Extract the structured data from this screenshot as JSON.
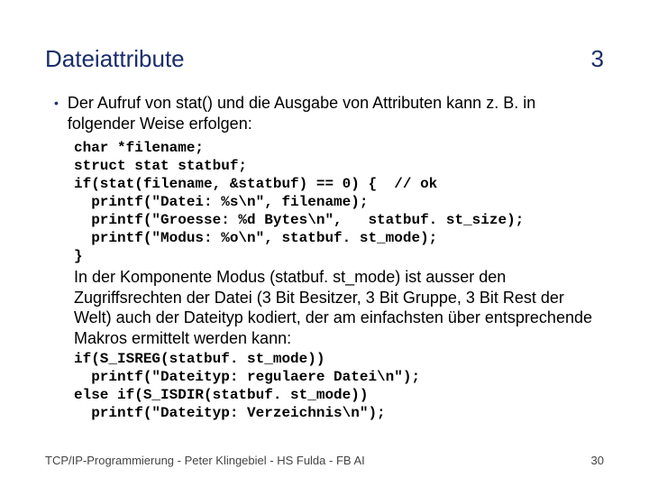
{
  "header": {
    "title": "Dateiattribute",
    "number": "3"
  },
  "bullet": {
    "text": "Der Aufruf von stat() und die Ausgabe von Attributen kann z. B. in folgender Weise erfolgen:"
  },
  "code1": "char *filename;\nstruct stat statbuf;\nif(stat(filename, &statbuf) == 0) {  // ok\n  printf(\"Datei: %s\\n\", filename);\n  printf(\"Groesse: %d Bytes\\n\",   statbuf. st_size);\n  printf(\"Modus: %o\\n\", statbuf. st_mode);\n}",
  "para1": "In der Komponente Modus (statbuf. st_mode) ist ausser den Zugriffsrechten der Datei (3 Bit Besitzer, 3 Bit Gruppe, 3 Bit Rest der Welt) auch der Dateityp kodiert, der am einfachsten über entsprechende Makros ermittelt werden kann:",
  "code2": "if(S_ISREG(statbuf. st_mode))\n  printf(\"Dateityp: regulaere Datei\\n\");\nelse if(S_ISDIR(statbuf. st_mode))\n  printf(\"Dateityp: Verzeichnis\\n\");",
  "footer": {
    "left": "TCP/IP-Programmierung - Peter Klingebiel - HS Fulda - FB AI",
    "right": "30"
  }
}
